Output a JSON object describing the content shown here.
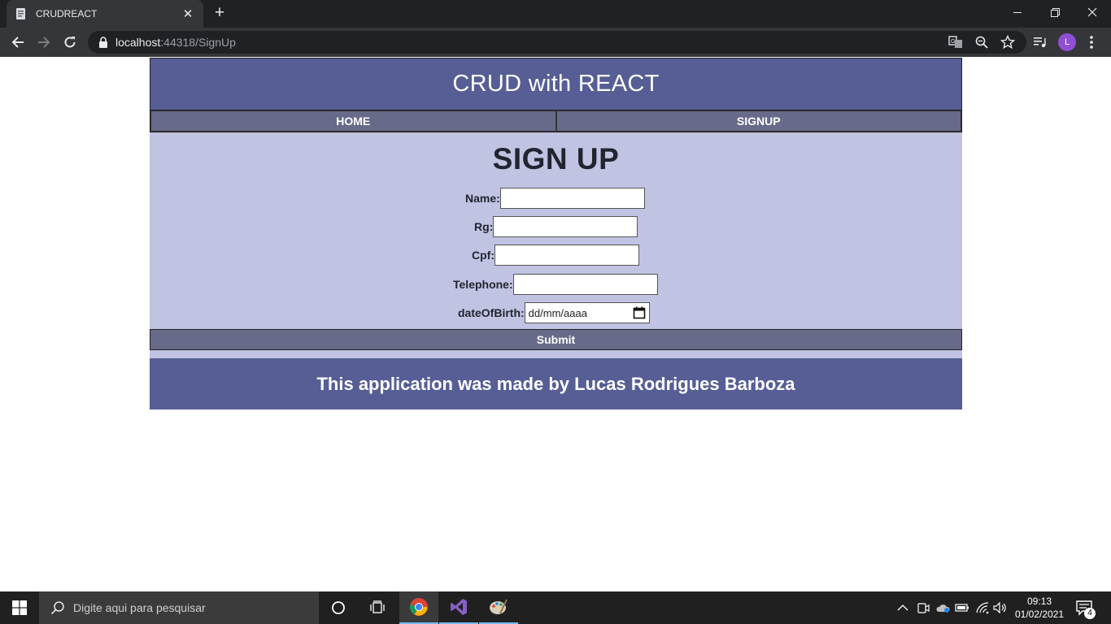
{
  "browser": {
    "tab_title": "CRUDREACT",
    "url_host": "localhost",
    "url_path": ":44318/SignUp",
    "profile_initial": "L"
  },
  "app": {
    "header_title": "CRUD with REACT",
    "nav": [
      {
        "label": "HOME"
      },
      {
        "label": "SIGNUP"
      }
    ],
    "form": {
      "title": "SIGN UP",
      "fields": [
        {
          "label": "Name:",
          "value": ""
        },
        {
          "label": "Rg:",
          "value": ""
        },
        {
          "label": "Cpf:",
          "value": ""
        },
        {
          "label": "Telephone:",
          "value": ""
        },
        {
          "label": "dateOfBirth:",
          "placeholder": "dd/mm/aaaa"
        }
      ],
      "submit_label": "Submit"
    },
    "footer_text": "This application was made by Lucas Rodrigues Barboza"
  },
  "taskbar": {
    "search_placeholder": "Digite aqui para pesquisar",
    "time": "09:13",
    "date": "01/02/2021",
    "notification_count": "4"
  },
  "colors": {
    "header_bg": "#565e95",
    "nav_bg": "#676a88",
    "form_bg": "#c0c3e2"
  }
}
